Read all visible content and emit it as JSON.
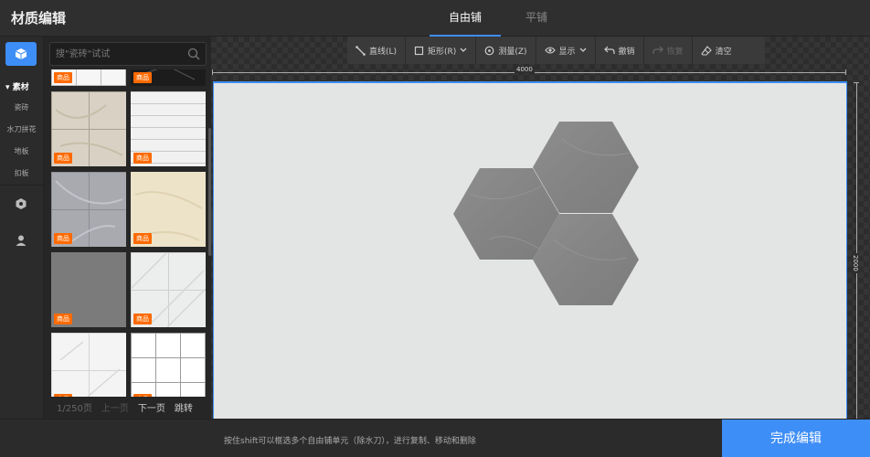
{
  "header": {
    "title": "材质编辑",
    "tabs": [
      {
        "label": "自由铺",
        "active": true
      },
      {
        "label": "平铺",
        "active": false
      }
    ]
  },
  "sidebar": {
    "category": "素材",
    "subcategories": [
      "瓷砖",
      "水刀拼花",
      "地板",
      "扣板"
    ],
    "icons": [
      "cube-icon",
      "hexagon-icon",
      "user-icon"
    ]
  },
  "materials": {
    "search_placeholder": "搜\"瓷砖\"试试",
    "badge": "商品",
    "tiles": [
      {
        "style": "white-grid-top",
        "badge": true
      },
      {
        "style": "black-marble-top",
        "badge": true
      },
      {
        "style": "beige-marble",
        "badge": true
      },
      {
        "style": "white-stripes",
        "badge": true
      },
      {
        "style": "grey-blue-marble",
        "badge": true
      },
      {
        "style": "cream-marble",
        "badge": true
      },
      {
        "style": "grey-stone",
        "badge": true
      },
      {
        "style": "white-veined",
        "badge": true
      },
      {
        "style": "white-marble-light",
        "badge": true
      },
      {
        "style": "white-large-grid",
        "badge": true
      }
    ],
    "pager": {
      "info": "1/250页",
      "prev": "上一页",
      "next": "下一页",
      "jump": "跳转"
    }
  },
  "toolbar": [
    {
      "name": "line",
      "label": "直线(L)",
      "icon": "line-icon",
      "enabled": true
    },
    {
      "name": "rect",
      "label": "矩形(R)",
      "icon": "rect-icon",
      "enabled": true,
      "dropdown": true
    },
    {
      "name": "measure",
      "label": "测量(Z)",
      "icon": "measure-icon",
      "enabled": true
    },
    {
      "name": "display",
      "label": "显示",
      "icon": "eye-icon",
      "enabled": true,
      "dropdown": true
    },
    {
      "name": "undo",
      "label": "撤销",
      "icon": "undo-icon",
      "enabled": true
    },
    {
      "name": "redo",
      "label": "恢复",
      "icon": "redo-icon",
      "enabled": false
    },
    {
      "name": "clear",
      "label": "清空",
      "icon": "eraser-icon",
      "enabled": true
    }
  ],
  "canvas": {
    "width_label": "4000",
    "height_label": "2000",
    "accent": "#3e8ef7",
    "floor_color": "#e3e5e4",
    "hex_tile_color": "#8a8a8a"
  },
  "footer": {
    "hint": "按住shift可以框选多个自由铺单元（除水刀），进行复制、移动和删除",
    "finish_label": "完成编辑"
  },
  "colors": {
    "brand": "#3e8ef7",
    "badge": "#ff6a00",
    "background": "#2b2b2b"
  }
}
